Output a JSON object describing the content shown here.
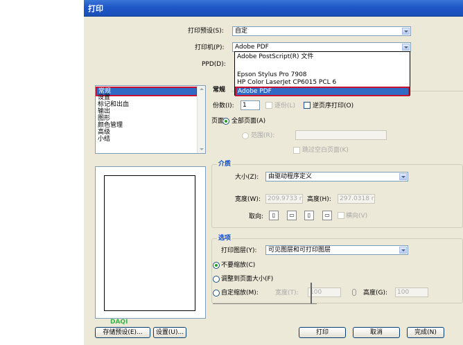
{
  "window": {
    "title": "打印"
  },
  "top": {
    "preset_label": "打印预设(S):",
    "preset_value": "自定",
    "printer_label": "打印机(P):",
    "printer_value": "Adobe PDF",
    "ppd_label": "PPD(D):"
  },
  "printer_options": [
    "Adobe PostScript(R) 文件",
    "Epson Stylus Pro 7908",
    "HP Color LaserJet CP6015 PCL 6",
    "Adobe PDF"
  ],
  "categories": [
    "常规",
    "设置",
    "标记和出血",
    "输出",
    "图形",
    "颜色管理",
    "高级",
    "小结"
  ],
  "general": {
    "section_title": "常规",
    "copies_label": "份数(I):",
    "copies_value": "1",
    "collate_label": "逐份(L)",
    "reverse_label": "逆页序打印(O)",
    "pages_label": "页面:",
    "all_pages_label": "全部页面(A)",
    "range_label": "范围(R):",
    "range_value": "",
    "skip_blank_label": "跳过空白页面(K)"
  },
  "media": {
    "title": "介质",
    "size_label": "大小(Z):",
    "size_value": "由驱动程序定义",
    "width_label": "宽度(W):",
    "width_value": "209.9733 r",
    "height_label": "高度(H):",
    "height_value": "297.0318 r",
    "orientation_label": "取向:",
    "orientation_icons": [
      "portrait-icon",
      "landscape-icon",
      "reverse-portrait-icon",
      "reverse-landscape-icon"
    ],
    "transverse_label": "横向(V)"
  },
  "options": {
    "title": "选项",
    "layers_label": "打印图层(Y):",
    "layers_value": "可见图层和可打印图层",
    "no_scale_label": "不要缩放(C)",
    "fit_label": "调整到页面大小(F)",
    "custom_label": "自定缩放(M):",
    "width_label": "宽度(T):",
    "width_value": "100",
    "height_label": "高度(G):",
    "height_value": "100"
  },
  "buttons": {
    "save_preset": "存储预设(E)...",
    "setup": "设置(U)...",
    "print": "打印",
    "cancel": "取消",
    "done": "完成(N)"
  },
  "watermark": "DAQI"
}
